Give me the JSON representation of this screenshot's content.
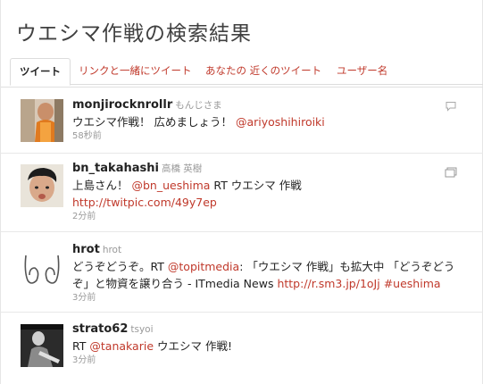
{
  "page": {
    "title": "ウエシマ作戦の検索結果"
  },
  "tabs": [
    {
      "label": "ツイート",
      "active": true
    },
    {
      "label": "リンクと一緒にツイート"
    },
    {
      "label": "あなたの 近くのツイート"
    },
    {
      "label": "ユーザー名"
    }
  ],
  "tweets": [
    {
      "screen_name": "monjirocknrollr",
      "real_name": "もんじさま",
      "text_parts": [
        "ウエシマ作戦！ 広めましょう！ ",
        "@ariyoshihiroiki"
      ],
      "time": "58秒前",
      "action_icon": "reply-icon"
    },
    {
      "screen_name": "bn_takahashi",
      "real_name": "高橋 英樹",
      "line1": [
        "上島さん！ ",
        "@bn_ueshima",
        " RT ウエシマ 作戦"
      ],
      "line2": "http://twitpic.com/49y7ep",
      "time": "2分前",
      "action_icon": "image-icon"
    },
    {
      "screen_name": "hrot",
      "real_name": "hrot",
      "line1": [
        "どうぞどうぞ。RT ",
        "@topitmedia",
        ": 「ウエシマ 作戦」も拡大中 「どうぞどう"
      ],
      "line2": [
        "ぞ」と物資を譲り合う - ITmedia News ",
        "http://r.sm3.jp/1oJj",
        " ",
        "#ueshima"
      ],
      "time": "3分前"
    },
    {
      "screen_name": "strato62",
      "real_name": "tsyoi",
      "text_parts": [
        "RT ",
        "@tanakarie",
        " ウエシマ 作戦!"
      ],
      "time": "3分前"
    }
  ],
  "colors": {
    "link": "#c0392b",
    "title": "#404040",
    "muted": "#999999"
  }
}
